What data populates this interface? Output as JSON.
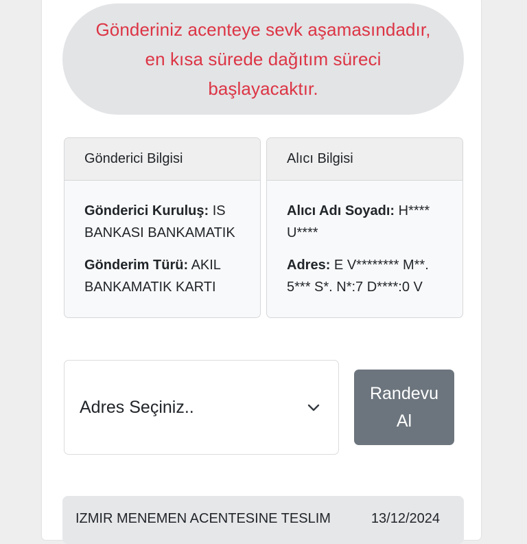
{
  "status": {
    "message_line1": "Gönderiniz acenteye sevk aşamasındadır,",
    "message_line2": "en kısa sürede dağıtım süreci",
    "message_line3": "başlayacaktır.",
    "color": "#dc3545"
  },
  "sender_card": {
    "title": "Gönderici Bilgisi",
    "institution_label": "Gönderici Kuruluş:",
    "institution_value": "IS BANKASI BANKAMATIK",
    "type_label": "Gönderim Türü:",
    "type_value": "AKIL BANKAMATIK KARTI"
  },
  "receiver_card": {
    "title": "Alıcı Bilgisi",
    "name_label": "Alıcı Adı Soyadı:",
    "name_value": "H**** U****",
    "address_label": "Adres:",
    "address_value": "E V******** M**. 5*** S*. N*:7 D****:0 V"
  },
  "address_select": {
    "selected": "Adres Seçiniz..",
    "icon": "chevron-down-icon"
  },
  "appointment_button": {
    "label": "Randevu Al",
    "color": "#6c757d"
  },
  "history": [
    {
      "event": "IZMIR MENEMEN ACENTESINE TESLIM",
      "date": "13/12/2024"
    }
  ]
}
